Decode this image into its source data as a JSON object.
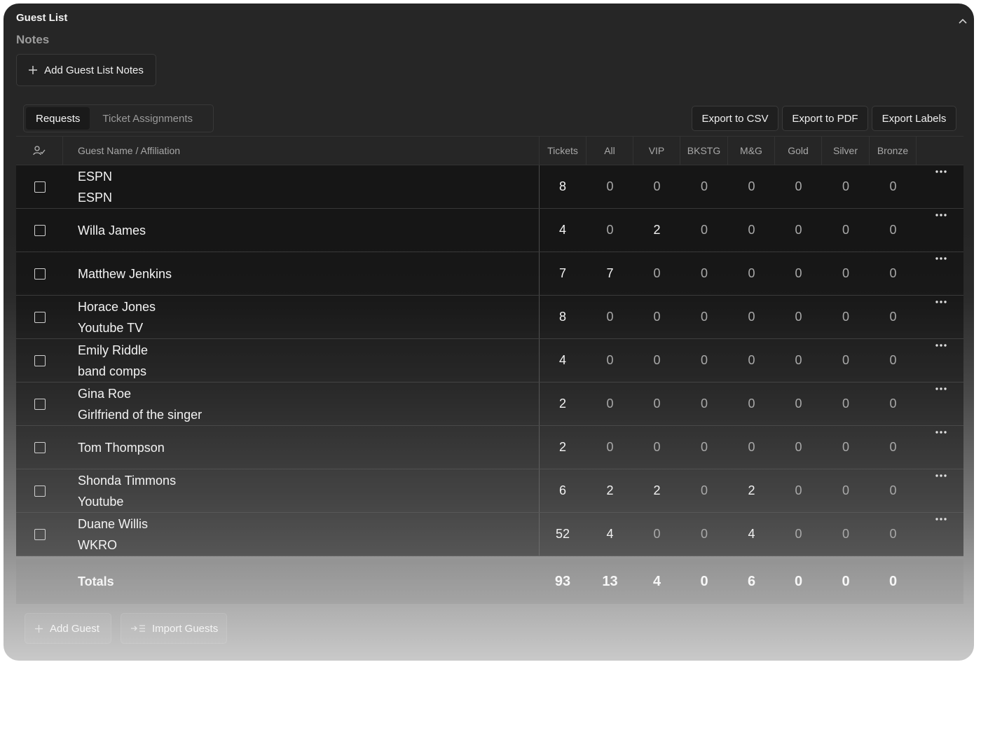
{
  "panel": {
    "title": "Guest List",
    "notes_title": "Notes",
    "add_notes_label": "Add Guest List Notes"
  },
  "tabs": [
    {
      "label": "Requests",
      "active": true
    },
    {
      "label": "Ticket Assignments",
      "active": false
    }
  ],
  "toolbar": {
    "export_csv": "Export to CSV",
    "export_pdf": "Export to PDF",
    "export_labels": "Export Labels"
  },
  "table": {
    "headers": {
      "name": "Guest Name / Affiliation",
      "tickets": "Tickets",
      "all": "All",
      "vip": "VIP",
      "bkstg": "BKSTG",
      "mg": "M&G",
      "gold": "Gold",
      "silver": "Silver",
      "bronze": "Bronze"
    },
    "rows": [
      {
        "name": "ESPN",
        "affiliation": "ESPN",
        "values": [
          8,
          0,
          0,
          0,
          0,
          0,
          0,
          0
        ]
      },
      {
        "name": "Willa James",
        "affiliation": "",
        "values": [
          4,
          0,
          2,
          0,
          0,
          0,
          0,
          0
        ]
      },
      {
        "name": "Matthew Jenkins",
        "affiliation": "",
        "values": [
          7,
          7,
          0,
          0,
          0,
          0,
          0,
          0
        ]
      },
      {
        "name": "Horace Jones",
        "affiliation": "Youtube TV",
        "values": [
          8,
          0,
          0,
          0,
          0,
          0,
          0,
          0
        ]
      },
      {
        "name": "Emily Riddle",
        "affiliation": "band comps",
        "values": [
          4,
          0,
          0,
          0,
          0,
          0,
          0,
          0
        ]
      },
      {
        "name": "Gina Roe",
        "affiliation": "Girlfriend of the singer",
        "values": [
          2,
          0,
          0,
          0,
          0,
          0,
          0,
          0
        ]
      },
      {
        "name": "Tom Thompson",
        "affiliation": "",
        "values": [
          2,
          0,
          0,
          0,
          0,
          0,
          0,
          0
        ]
      },
      {
        "name": "Shonda Timmons",
        "affiliation": "Youtube",
        "values": [
          6,
          2,
          2,
          0,
          2,
          0,
          0,
          0
        ]
      },
      {
        "name": "Duane Willis",
        "affiliation": "WKRO",
        "values": [
          52,
          4,
          0,
          0,
          4,
          0,
          0,
          0
        ]
      }
    ],
    "totals": {
      "label": "Totals",
      "values": [
        93,
        13,
        4,
        0,
        6,
        0,
        0,
        0
      ]
    }
  },
  "footer": {
    "add_guest": "Add Guest",
    "import_guests": "Import Guests"
  },
  "icons": {
    "collapse": "chevron-up-icon",
    "add": "plus-icon",
    "guest_status": "user-check-icon",
    "more": "more-horizontal-icon",
    "import": "import-list-icon"
  }
}
